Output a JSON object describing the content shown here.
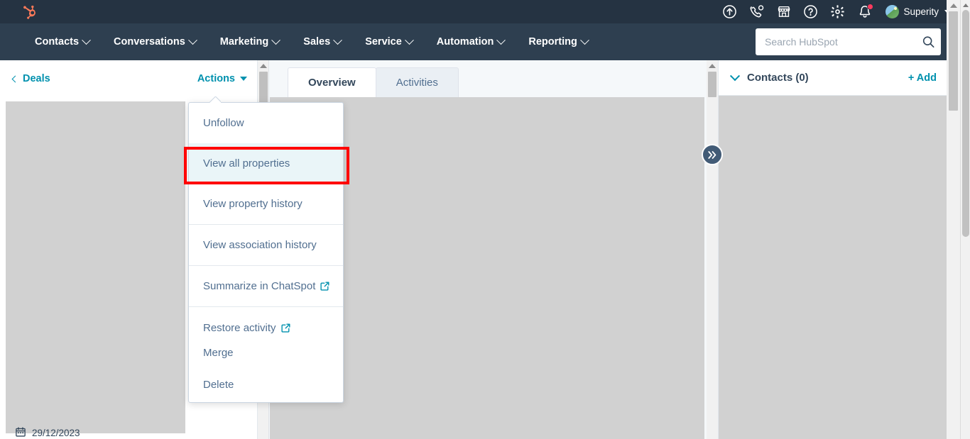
{
  "topbar": {
    "logo_name": "hubspot-sprocket-logo",
    "icons": [
      {
        "name": "upgrade-icon",
        "label": "Upgrade"
      },
      {
        "name": "calling-icon",
        "label": "Calling"
      },
      {
        "name": "marketplace-icon",
        "label": "Marketplace"
      },
      {
        "name": "help-icon",
        "label": "Help"
      },
      {
        "name": "settings-gear-icon",
        "label": "Settings"
      },
      {
        "name": "notifications-bell-icon",
        "label": "Notifications",
        "has_badge": true
      }
    ],
    "account": {
      "name": "Superity",
      "avatar_name": "account-avatar"
    }
  },
  "nav": {
    "items": [
      {
        "label": "Contacts"
      },
      {
        "label": "Conversations"
      },
      {
        "label": "Marketing"
      },
      {
        "label": "Sales"
      },
      {
        "label": "Service"
      },
      {
        "label": "Automation"
      },
      {
        "label": "Reporting"
      }
    ],
    "search": {
      "placeholder": "Search HubSpot",
      "value": ""
    }
  },
  "record": {
    "back_label": "Deals",
    "actions_label": "Actions",
    "date_value": "29/12/2023"
  },
  "tabs": [
    {
      "label": "Overview",
      "active": true
    },
    {
      "label": "Activities",
      "active": false
    }
  ],
  "actions_menu": {
    "groups": [
      {
        "items": [
          {
            "label": "Unfollow",
            "external": false,
            "highlighted": false
          },
          {
            "label": "View all properties",
            "external": false,
            "highlighted": true
          },
          {
            "label": "View property history",
            "external": false,
            "highlighted": false
          }
        ]
      },
      {
        "items": [
          {
            "label": "View association history",
            "external": false,
            "highlighted": false
          }
        ]
      },
      {
        "items": [
          {
            "label": "Summarize in ChatSpot",
            "external": true,
            "highlighted": false
          }
        ]
      },
      {
        "items": [
          {
            "label": "Restore activity",
            "external": true,
            "highlighted": false
          },
          {
            "label": "Merge",
            "external": false,
            "highlighted": false
          },
          {
            "label": "Delete",
            "external": false,
            "highlighted": false
          }
        ]
      }
    ]
  },
  "right_panel": {
    "collapse_icon": "double-chevron-right-icon",
    "title": "Contacts (0)",
    "add_label": "+ Add"
  },
  "colors": {
    "topbar_bg": "#253342",
    "nav_bg": "#2e3f50",
    "brand_orange": "#ff7a59",
    "link_teal": "#0091ae",
    "text_dark": "#33475b",
    "text_muted": "#516f90",
    "highlight_bg": "#eaf5f8",
    "annotation_red": "#ff0000",
    "skeleton_grey": "#d1d1d1",
    "page_bg": "#f5f8fa"
  }
}
